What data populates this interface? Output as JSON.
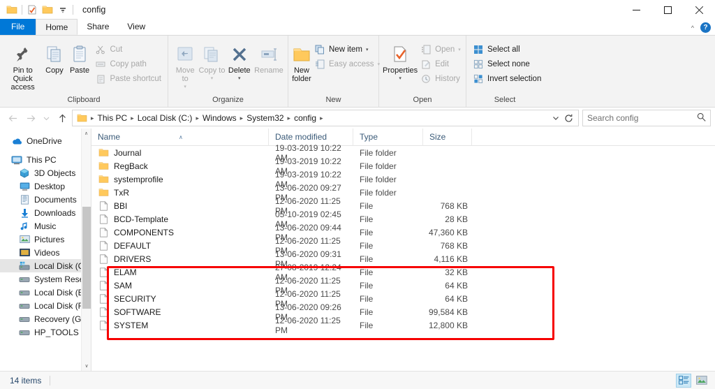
{
  "window": {
    "title": "config",
    "quick_access": [
      "folder-icon",
      "properties-icon",
      "new-folder-icon",
      "customize-dropdown-icon"
    ],
    "controls": {
      "minimize": "—",
      "maximize": "☐",
      "close": "✕"
    }
  },
  "ribbon": {
    "tabs": [
      {
        "label": "File",
        "state": "file-menu"
      },
      {
        "label": "Home",
        "state": "active"
      },
      {
        "label": "Share",
        "state": "normal"
      },
      {
        "label": "View",
        "state": "normal"
      }
    ],
    "collapse_label": "∧",
    "help_label": "?",
    "groups": [
      {
        "label": "Clipboard",
        "big": [
          {
            "label": "Pin to Quick access",
            "icon": "pin-icon",
            "disabled": false
          },
          {
            "label": "Copy",
            "icon": "copy-icon",
            "disabled": false
          },
          {
            "label": "Paste",
            "icon": "paste-icon",
            "disabled": false
          }
        ],
        "small": [
          {
            "label": "Cut",
            "icon": "scissors-icon",
            "disabled": true
          },
          {
            "label": "Copy path",
            "icon": "copy-path-icon",
            "disabled": true
          },
          {
            "label": "Paste shortcut",
            "icon": "paste-shortcut-icon",
            "disabled": true
          }
        ]
      },
      {
        "label": "Organize",
        "big": [
          {
            "label": "Move to",
            "icon": "move-to-icon",
            "disabled": true,
            "dropdown": true
          },
          {
            "label": "Copy to",
            "icon": "copy-to-icon",
            "disabled": true,
            "dropdown": true
          },
          {
            "label": "Delete",
            "icon": "delete-x-icon",
            "disabled": false,
            "dropdown": true
          },
          {
            "label": "Rename",
            "icon": "rename-icon",
            "disabled": true
          }
        ],
        "small": []
      },
      {
        "label": "New",
        "big": [
          {
            "label": "New folder",
            "icon": "new-folder-icon",
            "disabled": false
          }
        ],
        "small": [
          {
            "label": "New item",
            "icon": "new-item-icon",
            "disabled": false,
            "dropdown": true
          },
          {
            "label": "Easy access",
            "icon": "easy-access-icon",
            "disabled": true,
            "dropdown": true
          }
        ]
      },
      {
        "label": "Open",
        "big": [
          {
            "label": "Properties",
            "icon": "properties-icon",
            "disabled": false,
            "dropdown": true
          }
        ],
        "small": [
          {
            "label": "Open",
            "icon": "open-icon",
            "disabled": true,
            "dropdown": true
          },
          {
            "label": "Edit",
            "icon": "edit-icon",
            "disabled": true
          },
          {
            "label": "History",
            "icon": "history-icon",
            "disabled": true
          }
        ]
      },
      {
        "label": "Select",
        "big": [],
        "small": [
          {
            "label": "Select all",
            "icon": "select-all-icon",
            "disabled": false
          },
          {
            "label": "Select none",
            "icon": "select-none-icon",
            "disabled": false
          },
          {
            "label": "Invert selection",
            "icon": "invert-selection-icon",
            "disabled": false
          }
        ]
      }
    ]
  },
  "address": {
    "back_icon": "arrow-left-icon",
    "forward_icon": "arrow-right-icon",
    "recent_icon": "chevron-down-icon",
    "up_icon": "arrow-up-icon",
    "refresh_icon": "refresh-icon",
    "history_icon": "chevron-down-icon",
    "breadcrumbs": [
      "This PC",
      "Local Disk (C:)",
      "Windows",
      "System32",
      "config"
    ],
    "separator": "›"
  },
  "search": {
    "placeholder": "Search config",
    "icon": "search-icon"
  },
  "sidebar": {
    "items": [
      {
        "label": "OneDrive",
        "icon": "onedrive-cloud-icon",
        "indent": 0,
        "selected": false
      },
      {
        "label": "This PC",
        "icon": "this-pc-icon",
        "indent": 0,
        "selected": false
      },
      {
        "label": "3D Objects",
        "icon": "3d-objects-icon",
        "indent": 1,
        "selected": false
      },
      {
        "label": "Desktop",
        "icon": "desktop-icon",
        "indent": 1,
        "selected": false
      },
      {
        "label": "Documents",
        "icon": "documents-icon",
        "indent": 1,
        "selected": false
      },
      {
        "label": "Downloads",
        "icon": "downloads-icon",
        "indent": 1,
        "selected": false
      },
      {
        "label": "Music",
        "icon": "music-icon",
        "indent": 1,
        "selected": false
      },
      {
        "label": "Pictures",
        "icon": "pictures-icon",
        "indent": 1,
        "selected": false
      },
      {
        "label": "Videos",
        "icon": "videos-icon",
        "indent": 1,
        "selected": false
      },
      {
        "label": "Local Disk (C:)",
        "icon": "windows-drive-icon",
        "indent": 1,
        "selected": true
      },
      {
        "label": "System Reserved",
        "icon": "drive-icon",
        "indent": 1,
        "selected": false
      },
      {
        "label": "Local Disk (E:)",
        "icon": "drive-icon",
        "indent": 1,
        "selected": false
      },
      {
        "label": "Local Disk (F:)",
        "icon": "drive-icon",
        "indent": 1,
        "selected": false
      },
      {
        "label": "Recovery (G:)",
        "icon": "drive-icon",
        "indent": 1,
        "selected": false
      },
      {
        "label": "HP_TOOLS (H:)",
        "icon": "drive-icon",
        "indent": 1,
        "selected": false
      }
    ],
    "scroll_up": "∧",
    "scroll_down": "∨"
  },
  "filelist": {
    "columns": [
      "Name",
      "Date modified",
      "Type",
      "Size"
    ],
    "sort_column": "Name",
    "sort_direction": "ascending",
    "sort_caret": "∧",
    "rows": [
      {
        "name": "Journal",
        "date": "19-03-2019 10:22 AM",
        "type": "File folder",
        "size": "",
        "icon": "folder-icon",
        "highlighted": false
      },
      {
        "name": "RegBack",
        "date": "19-03-2019 10:22 AM",
        "type": "File folder",
        "size": "",
        "icon": "folder-icon",
        "highlighted": false
      },
      {
        "name": "systemprofile",
        "date": "19-03-2019 10:22 AM",
        "type": "File folder",
        "size": "",
        "icon": "folder-icon",
        "highlighted": false
      },
      {
        "name": "TxR",
        "date": "13-06-2020 09:27 PM",
        "type": "File folder",
        "size": "",
        "icon": "folder-icon",
        "highlighted": false
      },
      {
        "name": "BBI",
        "date": "12-06-2020 11:25 PM",
        "type": "File",
        "size": "768 KB",
        "icon": "generic-file-icon",
        "highlighted": false
      },
      {
        "name": "BCD-Template",
        "date": "05-10-2019 02:45 AM",
        "type": "File",
        "size": "28 KB",
        "icon": "generic-file-icon",
        "highlighted": false
      },
      {
        "name": "COMPONENTS",
        "date": "13-06-2020 09:44 PM",
        "type": "File",
        "size": "47,360 KB",
        "icon": "generic-file-icon",
        "highlighted": false
      },
      {
        "name": "DEFAULT",
        "date": "12-06-2020 11:25 PM",
        "type": "File",
        "size": "768 KB",
        "icon": "generic-file-icon",
        "highlighted": false
      },
      {
        "name": "DRIVERS",
        "date": "13-06-2020 09:31 PM",
        "type": "File",
        "size": "4,116 KB",
        "icon": "generic-file-icon",
        "highlighted": false
      },
      {
        "name": "ELAM",
        "date": "27-08-2019 12:24 AM",
        "type": "File",
        "size": "32 KB",
        "icon": "generic-file-icon",
        "highlighted": false
      },
      {
        "name": "SAM",
        "date": "12-06-2020 11:25 PM",
        "type": "File",
        "size": "64 KB",
        "icon": "generic-file-icon",
        "highlighted": true
      },
      {
        "name": "SECURITY",
        "date": "12-06-2020 11:25 PM",
        "type": "File",
        "size": "64 KB",
        "icon": "generic-file-icon",
        "highlighted": true
      },
      {
        "name": "SOFTWARE",
        "date": "13-06-2020 09:26 PM",
        "type": "File",
        "size": "99,584 KB",
        "icon": "generic-file-icon",
        "highlighted": true
      },
      {
        "name": "SYSTEM",
        "date": "12-06-2020 11:25 PM",
        "type": "File",
        "size": "12,800 KB",
        "icon": "generic-file-icon",
        "highlighted": true
      }
    ]
  },
  "annotation": {
    "color": "#f60000",
    "covers": [
      "SAM",
      "SECURITY",
      "SOFTWARE",
      "SYSTEM"
    ]
  },
  "statusbar": {
    "item_count": "14 items",
    "views": [
      {
        "name": "details-view-icon",
        "active": true
      },
      {
        "name": "large-icons-view-icon",
        "active": false
      }
    ]
  },
  "colors": {
    "accent": "#0078d7",
    "folder_yellow": "#ffc95c",
    "annotation_red": "#f60000",
    "selection_gray": "#e5e5e5"
  }
}
